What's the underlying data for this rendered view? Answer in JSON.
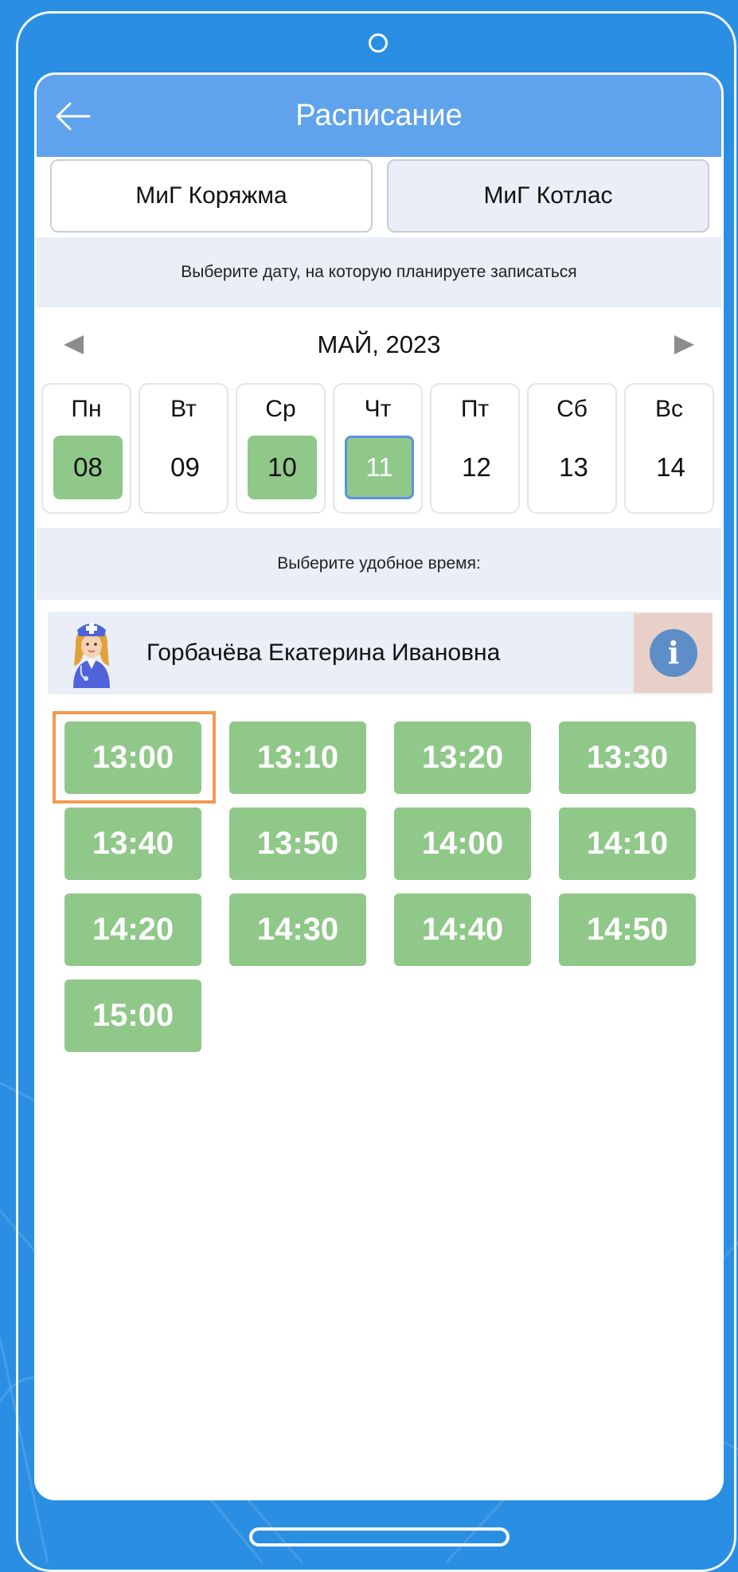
{
  "header": {
    "title": "Расписание",
    "back_icon": "arrow-left-icon"
  },
  "clinics": [
    {
      "label": "МиГ Коряжма",
      "active": true
    },
    {
      "label": "МиГ Котлас",
      "active": false
    }
  ],
  "date_hint": "Выберите дату, на которую планируете записаться",
  "calendar": {
    "month": "МАЙ, 2023",
    "prev_icon": "triangle-left-icon",
    "next_icon": "triangle-right-icon",
    "days": [
      {
        "name": "Пн",
        "date": "08",
        "available": true,
        "selected": false
      },
      {
        "name": "Вт",
        "date": "09",
        "available": false,
        "selected": false
      },
      {
        "name": "Ср",
        "date": "10",
        "available": true,
        "selected": false
      },
      {
        "name": "Чт",
        "date": "11",
        "available": true,
        "selected": true
      },
      {
        "name": "Пт",
        "date": "12",
        "available": false,
        "selected": false
      },
      {
        "name": "Сб",
        "date": "13",
        "available": false,
        "selected": false
      },
      {
        "name": "Вс",
        "date": "14",
        "available": false,
        "selected": false
      }
    ]
  },
  "time_hint": "Выберите удобное время:",
  "doctor": {
    "name": "Горбачёва Екатерина Ивановна",
    "avatar_icon": "nurse-avatar-icon",
    "info_icon": "info-icon",
    "info_symbol": "i"
  },
  "time_slots": [
    "13:00",
    "13:10",
    "13:20",
    "13:30",
    "13:40",
    "13:50",
    "14:00",
    "14:10",
    "14:20",
    "14:30",
    "14:40",
    "14:50",
    "15:00"
  ],
  "highlighted_slot": "13:00",
  "colors": {
    "background": "#2a8fe2",
    "header": "#5fa3ec",
    "available": "#8fc888",
    "selected_border": "#5b91e8",
    "panel": "#e9eef7",
    "info_box": "#e8cfc8",
    "info_icon": "#5e8ec7",
    "highlight": "#f39a4f"
  }
}
